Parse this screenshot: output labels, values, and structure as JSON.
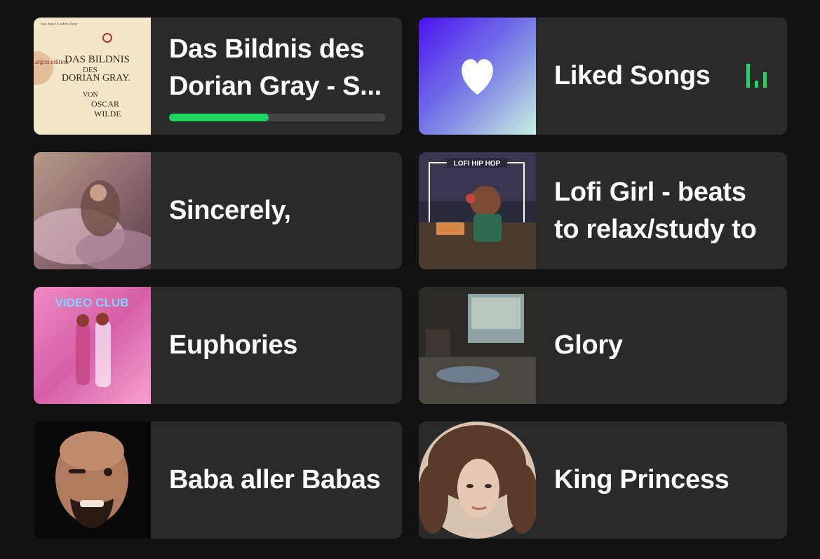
{
  "accent": "#1ed760",
  "cards": [
    {
      "title": "Das Bildnis des Dorian Gray - S...",
      "progress_percent": 46,
      "cover": {
        "publisher": "argon edition",
        "header": "Jan Josef Liefers liest",
        "title_line1": "DAS BILDNIS",
        "title_line2": "DES",
        "title_line3": "DORIAN GRAY.",
        "byline_von": "VON",
        "author1": "OSCAR",
        "author2": "WILDE"
      }
    },
    {
      "title": "Liked Songs",
      "now_playing": true
    },
    {
      "title": "Sincerely,"
    },
    {
      "title": "Lofi Girl - beats to relax/study to",
      "cover": {
        "banner": "LOFI HIP HOP"
      }
    },
    {
      "title": "Euphories",
      "cover": {
        "wordmark": "VIDEO CLUB"
      }
    },
    {
      "title": "Glory"
    },
    {
      "title": "Baba aller Babas"
    },
    {
      "title": "King Princess"
    }
  ]
}
